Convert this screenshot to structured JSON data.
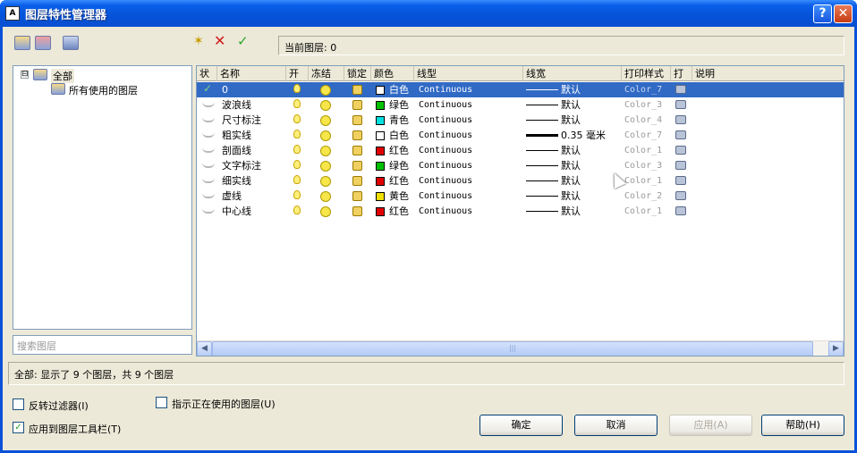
{
  "window": {
    "title": "图层特性管理器",
    "help_glyph": "?",
    "close_glyph": "✕"
  },
  "toolbar": {
    "current_layer_label": "当前图层: 0"
  },
  "tree": {
    "root_label": "全部",
    "child_label": "所有使用的图层",
    "expander": "⊟"
  },
  "search": {
    "placeholder": "搜索图层"
  },
  "grid": {
    "headers": [
      "状",
      "名称",
      "开",
      "冻结",
      "锁定",
      "颜色",
      "线型",
      "线宽",
      "打印样式",
      "打",
      "说明"
    ],
    "rows": [
      {
        "name": "0",
        "color_name": "白色",
        "color_hex": "#ffffff",
        "linetype": "Continuous",
        "lineweight": "默认",
        "plot_style": "Color_7",
        "thick": false,
        "current": true
      },
      {
        "name": "波浪线",
        "color_name": "绿色",
        "color_hex": "#00c000",
        "linetype": "Continuous",
        "lineweight": "默认",
        "plot_style": "Color_3",
        "thick": false,
        "current": false
      },
      {
        "name": "尺寸标注",
        "color_name": "青色",
        "color_hex": "#00e0e0",
        "linetype": "Continuous",
        "lineweight": "默认",
        "plot_style": "Color_4",
        "thick": false,
        "current": false
      },
      {
        "name": "粗实线",
        "color_name": "白色",
        "color_hex": "#ffffff",
        "linetype": "Continuous",
        "lineweight": "0.35 毫米",
        "plot_style": "Color_7",
        "thick": true,
        "current": false
      },
      {
        "name": "剖面线",
        "color_name": "红色",
        "color_hex": "#e00000",
        "linetype": "Continuous",
        "lineweight": "默认",
        "plot_style": "Color_1",
        "thick": false,
        "current": false
      },
      {
        "name": "文字标注",
        "color_name": "绿色",
        "color_hex": "#00c000",
        "linetype": "Continuous",
        "lineweight": "默认",
        "plot_style": "Color_3",
        "thick": false,
        "current": false
      },
      {
        "name": "细实线",
        "color_name": "红色",
        "color_hex": "#e00000",
        "linetype": "Continuous",
        "lineweight": "默认",
        "plot_style": "Color_1",
        "thick": false,
        "current": false
      },
      {
        "name": "虚线",
        "color_name": "黄色",
        "color_hex": "#f0e000",
        "linetype": "Continuous",
        "lineweight": "默认",
        "plot_style": "Color_2",
        "thick": false,
        "current": false
      },
      {
        "name": "中心线",
        "color_name": "红色",
        "color_hex": "#e00000",
        "linetype": "Continuous",
        "lineweight": "默认",
        "plot_style": "Color_1",
        "thick": false,
        "current": false
      }
    ],
    "scroll_left": "◀",
    "scroll_right": "▶",
    "scroll_grip": "|||"
  },
  "status": {
    "text": "全部: 显示了 9 个图层，共 9 个图层"
  },
  "options": {
    "invert_filter": "反转过滤器(I)",
    "indicate_in_use": "指示正在使用的图层(U)",
    "apply_to_toolbar": "应用到图层工具栏(T)",
    "invert_filter_checked": false,
    "indicate_in_use_checked": false,
    "apply_to_toolbar_checked": true,
    "check_glyph": "✓"
  },
  "buttons": {
    "ok": "确定",
    "cancel": "取消",
    "apply": "应用(A)",
    "help": "帮助(H)"
  },
  "icons": {
    "new_layer": "✶",
    "delete_layer": "✕",
    "set_current": "✓"
  }
}
